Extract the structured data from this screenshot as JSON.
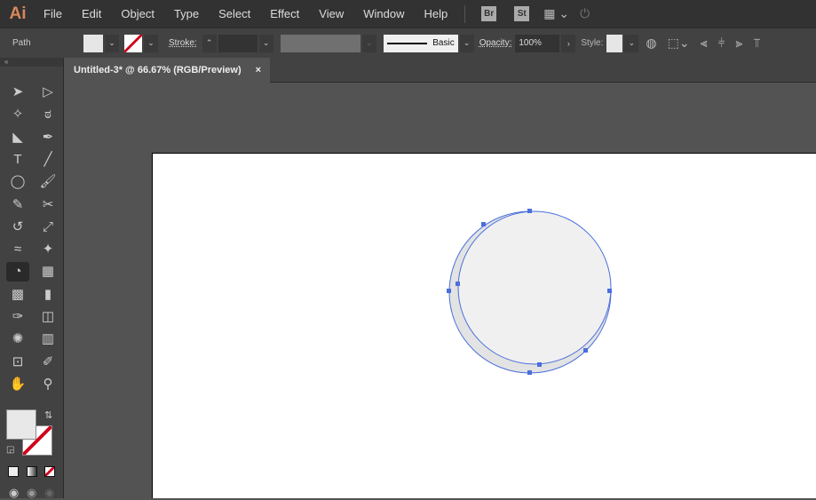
{
  "app": {
    "logo": "Ai",
    "menus": [
      "File",
      "Edit",
      "Object",
      "Type",
      "Select",
      "Effect",
      "View",
      "Window",
      "Help"
    ],
    "bridge": "Br",
    "stock": "St"
  },
  "control": {
    "selection": "Path",
    "stroke_label": "Stroke:",
    "brush": "Basic",
    "opacity_label": "Opacity:",
    "opacity": "100%",
    "style_label": "Style:"
  },
  "document": {
    "tab_title": "Untitled-3* @ 66.67% (RGB/Preview)",
    "close": "×"
  },
  "colors": {
    "fill": "#f0f0f0",
    "selection": "#4a6fdc",
    "stroke_none": "#d0021b"
  },
  "tools": [
    [
      "selection",
      "direct-selection"
    ],
    [
      "magic-wand",
      "lasso"
    ],
    [
      "line-segment-alt",
      "pen"
    ],
    [
      "type",
      "line"
    ],
    [
      "ellipse",
      "paintbrush"
    ],
    [
      "blob-brush",
      "scissors"
    ],
    [
      "rotate",
      "scale"
    ],
    [
      "warp",
      "puppet-warp"
    ],
    [
      "shape-builder",
      "perspective-grid"
    ],
    [
      "mesh",
      "gradient"
    ],
    [
      "eyedropper",
      "blend"
    ],
    [
      "symbol-sprayer",
      "graph"
    ],
    [
      "artboard",
      "slice"
    ],
    [
      "hand",
      "zoom"
    ]
  ]
}
